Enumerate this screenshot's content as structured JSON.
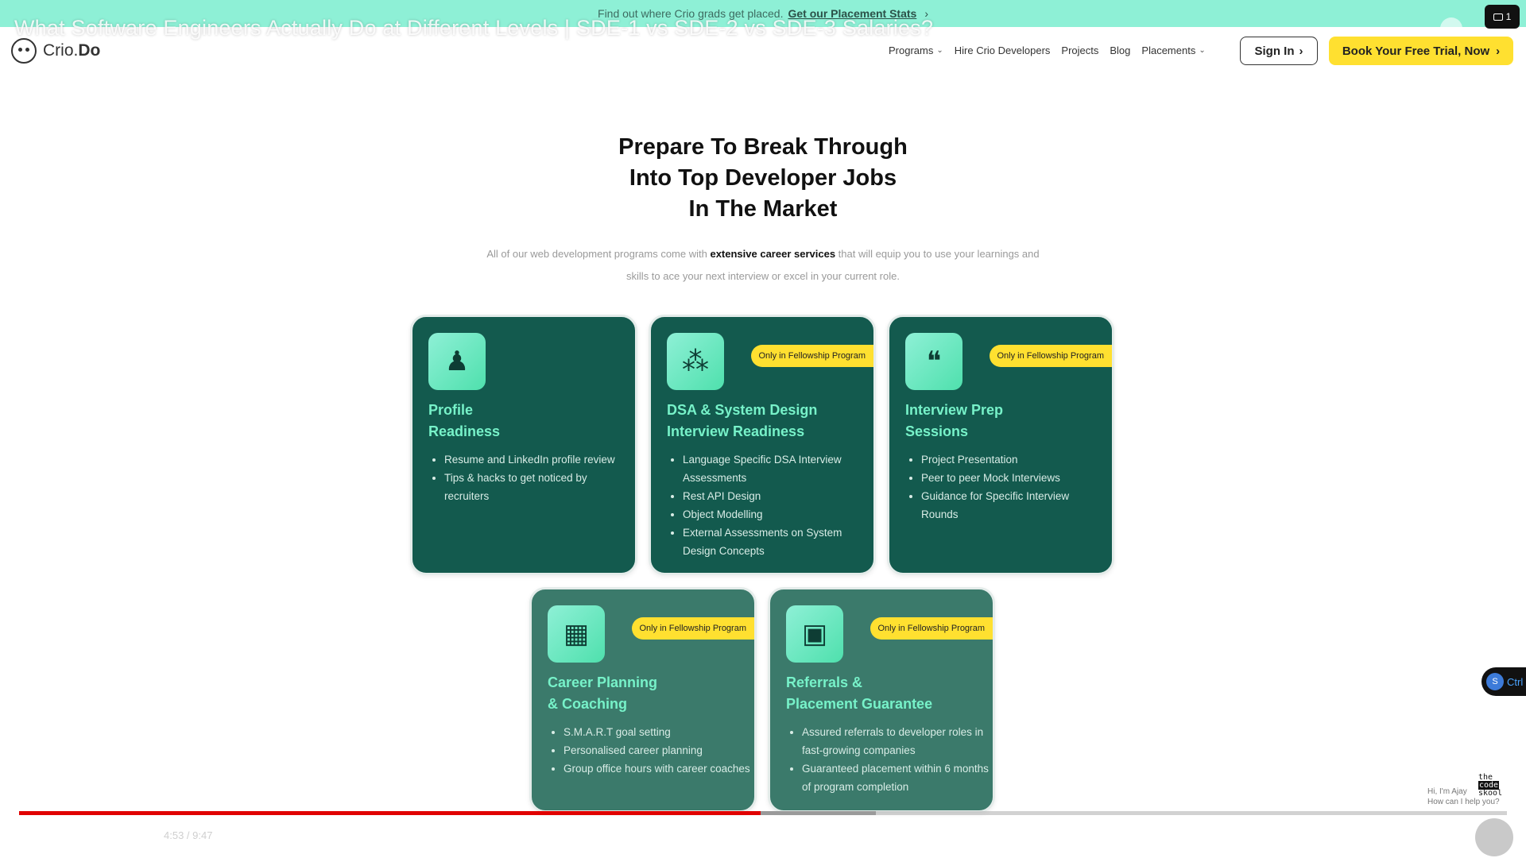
{
  "promo": {
    "text": "Find out where Crio grads get placed.",
    "link": "Get our Placement Stats",
    "chevron": "›"
  },
  "video": {
    "title": "What Software Engineers Actually Do at Different Levels | SDE-1 vs SDE-2 vs SDE-3 Salaries?",
    "time": "4:53 / 9:47",
    "played_fraction": 0.4986,
    "buffered_fraction": 0.576,
    "queue_count": "1"
  },
  "nav": {
    "logo_light": "Crio.",
    "logo_bold": "Do",
    "links": [
      {
        "label": "Programs",
        "caret": true
      },
      {
        "label": "Hire Crio Developers",
        "caret": false
      },
      {
        "label": "Projects",
        "caret": false
      },
      {
        "label": "Blog",
        "caret": false
      },
      {
        "label": "Placements",
        "caret": true
      }
    ],
    "signin": "Sign In",
    "trial": "Book Your Free Trial, Now"
  },
  "hero": {
    "title_line1": "Prepare To Break Through",
    "title_line2": "Into Top Developer Jobs",
    "title_line3": "In The Market",
    "sub_pre": "All of our web development programs come with",
    "sub_bold": "extensive career services",
    "sub_post": "that will equip you to use your learnings and skills to ace your next interview or excel in your current role."
  },
  "cards": [
    {
      "icon": "person-icon",
      "badge": "",
      "title_line1": "Profile",
      "title_line2": "Readiness",
      "bullets": [
        "Resume and LinkedIn profile review",
        "Tips & hacks to get noticed by recruiters"
      ]
    },
    {
      "icon": "nodes-icon",
      "badge": "Only in Fellowship Program",
      "title_line1": "DSA & System Design",
      "title_line2": "Interview Readiness",
      "bullets": [
        "Language Specific DSA Interview Assessments",
        "Rest API Design",
        "Object Modelling",
        "External Assessments on System Design Concepts"
      ]
    },
    {
      "icon": "chat-bubble-icon",
      "badge": "Only in Fellowship Program",
      "title_line1": "Interview Prep",
      "title_line2": "Sessions",
      "bullets": [
        "Project Presentation",
        "Peer to peer Mock Interviews",
        "Guidance for Specific Interview Rounds"
      ]
    },
    {
      "icon": "calendar-icon",
      "badge": "Only in Fellowship Program",
      "title_line1": "Career Planning",
      "title_line2": "& Coaching",
      "bullets": [
        "S.M.A.R.T goal setting",
        "Personalised career planning",
        "Group office hours with career coaches"
      ]
    },
    {
      "icon": "briefcase-icon",
      "badge": "Only in Fellowship Program",
      "title_line1": "Referrals &",
      "title_line2": "Placement Guarantee",
      "bullets": [
        "Assured referrals to developer roles in fast-growing companies",
        "Guaranteed placement within 6 months of program completion"
      ]
    }
  ],
  "widgets": {
    "chat_pill_letter": "S",
    "chat_pill_text": "Ctrl",
    "hi_line1": "Hi, I'm Ajay",
    "hi_line2": "How can I help you?",
    "brand_line1": "the",
    "brand_line2": "code",
    "brand_line3": "skool"
  }
}
